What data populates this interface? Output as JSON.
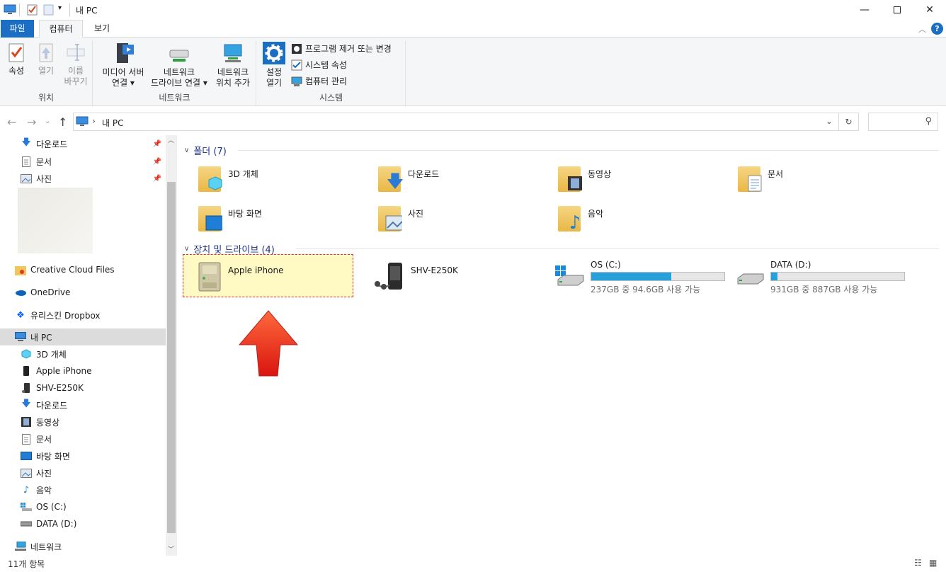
{
  "window": {
    "title": "내 PC"
  },
  "tabs": {
    "file": "파일",
    "computer": "컴퓨터",
    "view": "보기"
  },
  "ribbon": {
    "location": {
      "label": "위치",
      "properties": "속성",
      "open": "열기",
      "rename_1": "이름",
      "rename_2": "바꾸기"
    },
    "network": {
      "label": "네트워크",
      "media_1": "미디어 서버",
      "media_2": "연결 ▾",
      "map_1": "네트워크",
      "map_2": "드라이브 연결 ▾",
      "add_1": "네트워크",
      "add_2": "위치 추가"
    },
    "system": {
      "label": "시스템",
      "settings_1": "설정",
      "settings_2": "열기",
      "uninstall": "프로그램 제거 또는 변경",
      "sysprops": "시스템 속성",
      "manage": "컴퓨터 관리"
    }
  },
  "address": {
    "path": "내 PC"
  },
  "nav": {
    "quick": [
      {
        "label": "다운로드"
      },
      {
        "label": "문서"
      },
      {
        "label": "사진"
      }
    ],
    "creative_cloud": "Creative Cloud Files",
    "onedrive": "OneDrive",
    "dropbox": "유리스킨 Dropbox",
    "thispc": "내 PC",
    "pc_children": [
      {
        "label": "3D 개체"
      },
      {
        "label": "Apple iPhone"
      },
      {
        "label": "SHV-E250K"
      },
      {
        "label": "다운로드"
      },
      {
        "label": "동영상"
      },
      {
        "label": "문서"
      },
      {
        "label": "바탕 화면"
      },
      {
        "label": "사진"
      },
      {
        "label": "음악"
      },
      {
        "label": "OS (C:)"
      },
      {
        "label": "DATA (D:)"
      }
    ],
    "network": "네트워크"
  },
  "content": {
    "folders_header": "폴더 (7)",
    "folders": [
      {
        "label": "3D 개체"
      },
      {
        "label": "다운로드"
      },
      {
        "label": "동영상"
      },
      {
        "label": "문서"
      },
      {
        "label": "바탕 화면"
      },
      {
        "label": "사진"
      },
      {
        "label": "음악"
      }
    ],
    "devices_header": "장치 및 드라이브 (4)",
    "devices": [
      {
        "label": "Apple iPhone"
      },
      {
        "label": "SHV-E250K"
      },
      {
        "label": "OS (C:)",
        "sub": "237GB 중 94.6GB 사용 가능",
        "used_fraction": 0.6
      },
      {
        "label": "DATA (D:)",
        "sub": "931GB 중 887GB 사용 가능",
        "used_fraction": 0.05
      }
    ]
  },
  "status": {
    "count": "11개 항목"
  },
  "colors": {
    "accent": "#1a6fc4",
    "selection": "#fff9c4",
    "selection_border": "#e03030",
    "arrow": "#e8281a"
  }
}
